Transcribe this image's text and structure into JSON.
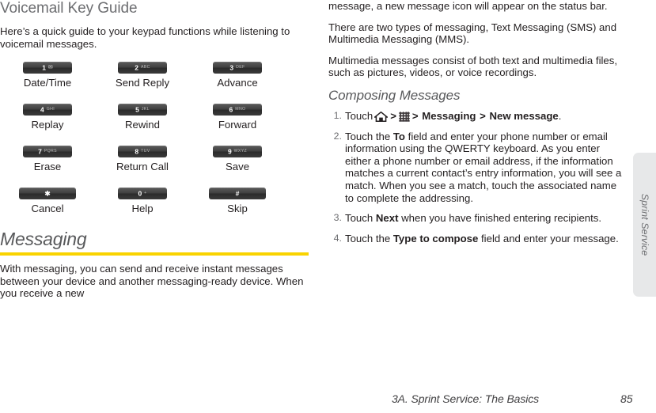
{
  "left_column": {
    "section_title": "Voicemail Key Guide",
    "intro_paragraph": "Here’s a quick guide to your keypad functions while listening to voicemail messages.",
    "keypad": [
      [
        {
          "digit": "1",
          "letters": "",
          "glyph": "envelope-icon",
          "glyph_char": "✉",
          "label": "Date/Time"
        },
        {
          "digit": "2",
          "letters": "ABC",
          "glyph": "",
          "glyph_char": "",
          "label": "Send Reply"
        },
        {
          "digit": "3",
          "letters": "DEF",
          "glyph": "",
          "glyph_char": "",
          "label": "Advance"
        }
      ],
      [
        {
          "digit": "4",
          "letters": "GHI",
          "glyph": "",
          "glyph_char": "",
          "label": "Replay"
        },
        {
          "digit": "5",
          "letters": "JKL",
          "glyph": "",
          "glyph_char": "",
          "label": "Rewind"
        },
        {
          "digit": "6",
          "letters": "MNO",
          "glyph": "",
          "glyph_char": "",
          "label": "Forward"
        }
      ],
      [
        {
          "digit": "7",
          "letters": "PQRS",
          "glyph": "",
          "glyph_char": "",
          "label": "Erase"
        },
        {
          "digit": "8",
          "letters": "TUV",
          "glyph": "",
          "glyph_char": "",
          "label": "Return Call"
        },
        {
          "digit": "9",
          "letters": "WXYZ",
          "glyph": "",
          "glyph_char": "",
          "label": "Save"
        }
      ],
      [
        {
          "digit": "✱",
          "letters": "",
          "glyph": "",
          "glyph_char": "",
          "label": "Cancel"
        },
        {
          "digit": "0",
          "letters": "+",
          "glyph": "",
          "glyph_char": "",
          "label": "Help"
        },
        {
          "digit": "#",
          "letters": "",
          "glyph": "",
          "glyph_char": "",
          "label": "Skip"
        }
      ]
    ],
    "chapter_title": "Messaging",
    "messaging_paragraph": "With messaging, you can send and receive instant messages between your device and another messaging-ready device. When you receive a new"
  },
  "right_column": {
    "continued_paragraph": "message, a new message icon will appear on the status bar.",
    "paragraph_2": "There are two types of messaging, Text Messaging (SMS) and Multimedia Messaging (MMS).",
    "paragraph_3": "Multimedia messages consist of both text and multimedia files, such as pictures, videos, or voice recordings.",
    "subsection_title": "Composing Messages",
    "steps": [
      {
        "number": "1.",
        "prefix": "Touch",
        "home_icon": "home-icon",
        "sep1": ">",
        "apps_icon": "apps-grid-icon",
        "sep2": ">",
        "bold1": "Messaging",
        "sep3": ">",
        "bold2": "New message",
        "suffix": "."
      },
      {
        "number": "2.",
        "prefix": "Touch the",
        "bold1": "To",
        "rest": "field and enter your phone number or email information using the QWERTY keyboard. As you enter either a phone number or email address, if the information matches a current contact’s entry information, you will see a match. When you see a match, touch the associated name to complete the addressing."
      },
      {
        "number": "3.",
        "prefix": "Touch",
        "bold1": "Next",
        "rest": "when you have finished entering recipients."
      },
      {
        "number": "4.",
        "prefix": "Touch the",
        "bold1": "Type to compose",
        "rest": "field and enter your message."
      }
    ]
  },
  "side_tab": {
    "label": "Sprint Service"
  },
  "footer": {
    "chapter": "3A. Sprint Service: The Basics",
    "page_number": "85"
  },
  "colors": {
    "rule_gold": "#f9d300",
    "heading_gray": "#58595b",
    "side_tab_bg": "#e7e8e9",
    "key_dark": "#3a3a3a"
  }
}
